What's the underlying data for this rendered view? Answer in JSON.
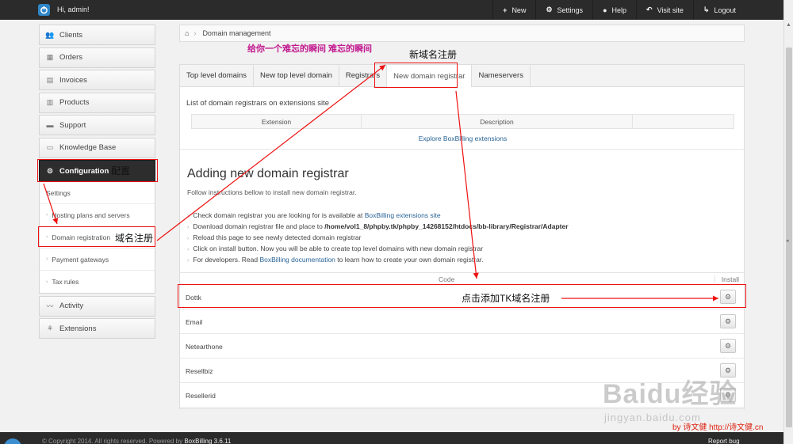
{
  "topbar": {
    "greeting": "Hi, admin!",
    "nav": [
      {
        "icon": "+",
        "icon_name": "plus-icon",
        "label": "New"
      },
      {
        "icon": "⚙",
        "icon_name": "gear-icon",
        "label": "Settings"
      },
      {
        "icon": "●",
        "icon_name": "help-icon",
        "label": "Help"
      },
      {
        "icon": "↶",
        "icon_name": "visit-icon",
        "label": "Visit site"
      },
      {
        "icon": "↳",
        "icon_name": "logout-icon",
        "label": "Logout"
      }
    ]
  },
  "sidebar": {
    "items": [
      {
        "icon": "👥",
        "label": "Clients"
      },
      {
        "icon": "▦",
        "label": "Orders"
      },
      {
        "icon": "▤",
        "label": "Invoices"
      },
      {
        "icon": "▥",
        "label": "Products"
      },
      {
        "icon": "▬",
        "label": "Support"
      },
      {
        "icon": "▭",
        "label": "Knowledge Base"
      },
      {
        "icon": "⚙",
        "label": "Configuration"
      },
      {
        "icon": "〰",
        "label": "Activity"
      },
      {
        "icon": "⚘",
        "label": "Extensions"
      }
    ],
    "config_sub": [
      "Settings",
      "Hosting plans and servers",
      "Domain registration",
      "Payment gateways",
      "Tax rules"
    ]
  },
  "breadcrumb": {
    "page": "Domain management"
  },
  "tabs": [
    "Top level domains",
    "New top level domain",
    "Registrars",
    "New domain registrar",
    "Nameservers"
  ],
  "main": {
    "section_title": "List of domain registrars on extensions site",
    "table_headers": [
      "Extension",
      "Description"
    ],
    "explore_link": "Explore BoxBilling extensions",
    "heading": "Adding new domain registrar",
    "intro": "Follow instructions bellow to install new domain registrar.",
    "steps": [
      {
        "pre": "Check domain registrar you are looking for is available at ",
        "link": "BoxBilling extensions site",
        "post": ""
      },
      {
        "pre": "Download domain registrar file and place to ",
        "bold": "/home/vol1_8/phpby.tk/phpby_14268152/htdocs/bb-library/Registrar/Adapter",
        "post": ""
      },
      {
        "pre": "Reload this page to see newly detected domain registrar",
        "post": ""
      },
      {
        "pre": "Click on install button. Now you will be able to create top level domains with new domain registrar",
        "post": ""
      },
      {
        "pre": "For developers. Read ",
        "link": "BoxBilling documentation",
        "post": " to learn how to create your own domain registrar."
      }
    ],
    "code_header": "Code",
    "install_header": "Install",
    "registrars": [
      "Dottk",
      "Email",
      "Netearthone",
      "Resellbiz",
      "Resellerid"
    ]
  },
  "footer": {
    "copyright": "© Copyright 2014. All rights reserved. Powered by ",
    "brand": "BoxBilling 3.6.11",
    "report": "Report bug"
  },
  "annotations": {
    "config_note": "配置",
    "domain_reg_note": "域名注册",
    "new_registrar_note": "新域名注册",
    "magenta_note": "给你一个难忘的瞬间 难忘的瞬间",
    "install_note": "点击添加TK域名注册",
    "credit": "by 诗文健 http://诗文健.cn"
  },
  "watermark": {
    "big": "Baidu经验",
    "small": "jingyan.baidu.com"
  },
  "colors": {
    "topbar": "#2b2b2b",
    "accent_red": "#e11111",
    "link": "#2a6496",
    "logo_blue": "#2f86c8"
  }
}
